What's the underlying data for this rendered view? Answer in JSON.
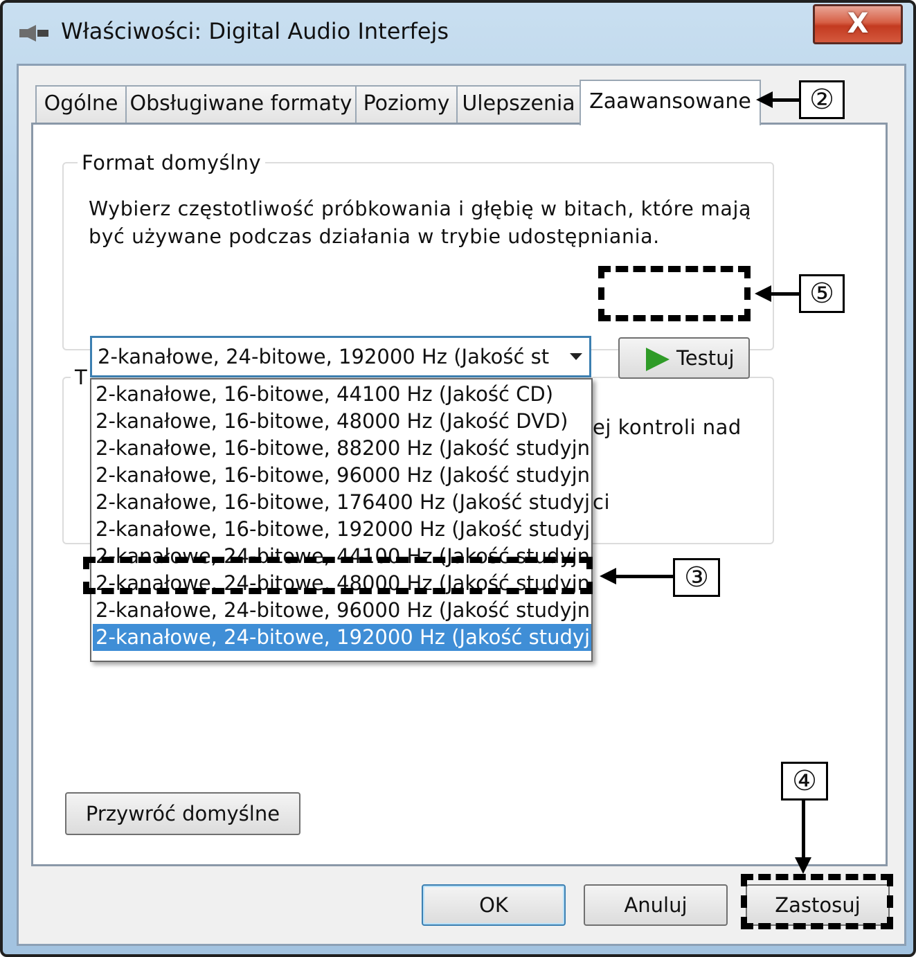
{
  "window": {
    "title": "Właściwości: Digital Audio Interfejs",
    "close_label": "X"
  },
  "tabs": [
    {
      "label": "Ogólne"
    },
    {
      "label": "Obsługiwane formaty"
    },
    {
      "label": "Poziomy"
    },
    {
      "label": "Ulepszenia"
    },
    {
      "label": "Zaawansowane",
      "active": true
    }
  ],
  "default_format": {
    "group_title": "Format domyślny",
    "description_line1": "Wybierz częstotliwość próbkowania i głębię w bitach, które mają",
    "description_line2": "być używane podczas działania w trybie udostępniania.",
    "selected_value": "2-kanałowe, 24-bitowe, 192000 Hz (Jakość st",
    "options": [
      "2-kanałowe, 16-bitowe, 44100 Hz (Jakość CD)",
      "2-kanałowe, 16-bitowe, 48000 Hz (Jakość DVD)",
      "2-kanałowe, 16-bitowe, 88200 Hz (Jakość studyjn",
      "2-kanałowe, 16-bitowe, 96000 Hz (Jakość studyjn",
      "2-kanałowe, 16-bitowe, 176400 Hz (Jakość studyj",
      "2-kanałowe, 16-bitowe, 192000 Hz (Jakość studyj",
      "2-kanałowe, 24-bitowe, 44100 Hz (Jakość studyjn",
      "2-kanałowe, 24-bitowe, 48000 Hz (Jakość studyjn",
      "2-kanałowe, 24-bitowe, 96000 Hz (Jakość studyjn",
      "2-kanałowe, 24-bitowe, 192000 Hz (Jakość studyj"
    ],
    "selected_index": 9,
    "test_button": "Testuj"
  },
  "exclusive_mode": {
    "group_title_fragment": "T",
    "text_fragment_1": "ej kontroli nad",
    "text_fragment_2": "ci"
  },
  "buttons": {
    "restore_defaults": "Przywróć domyślne",
    "ok": "OK",
    "cancel": "Anuluj",
    "apply": "Zastosuj"
  },
  "callouts": {
    "tab": "②",
    "option": "③",
    "apply": "④",
    "test": "⑤"
  }
}
